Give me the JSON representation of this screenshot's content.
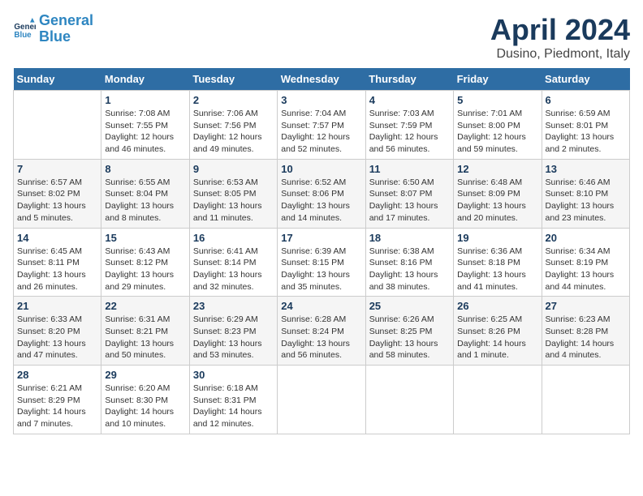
{
  "logo": {
    "line1": "General",
    "line2": "Blue"
  },
  "title": "April 2024",
  "subtitle": "Dusino, Piedmont, Italy",
  "weekdays": [
    "Sunday",
    "Monday",
    "Tuesday",
    "Wednesday",
    "Thursday",
    "Friday",
    "Saturday"
  ],
  "weeks": [
    [
      {
        "day": null
      },
      {
        "day": "1",
        "sunrise": "Sunrise: 7:08 AM",
        "sunset": "Sunset: 7:55 PM",
        "daylight": "Daylight: 12 hours and 46 minutes."
      },
      {
        "day": "2",
        "sunrise": "Sunrise: 7:06 AM",
        "sunset": "Sunset: 7:56 PM",
        "daylight": "Daylight: 12 hours and 49 minutes."
      },
      {
        "day": "3",
        "sunrise": "Sunrise: 7:04 AM",
        "sunset": "Sunset: 7:57 PM",
        "daylight": "Daylight: 12 hours and 52 minutes."
      },
      {
        "day": "4",
        "sunrise": "Sunrise: 7:03 AM",
        "sunset": "Sunset: 7:59 PM",
        "daylight": "Daylight: 12 hours and 56 minutes."
      },
      {
        "day": "5",
        "sunrise": "Sunrise: 7:01 AM",
        "sunset": "Sunset: 8:00 PM",
        "daylight": "Daylight: 12 hours and 59 minutes."
      },
      {
        "day": "6",
        "sunrise": "Sunrise: 6:59 AM",
        "sunset": "Sunset: 8:01 PM",
        "daylight": "Daylight: 13 hours and 2 minutes."
      }
    ],
    [
      {
        "day": "7",
        "sunrise": "Sunrise: 6:57 AM",
        "sunset": "Sunset: 8:02 PM",
        "daylight": "Daylight: 13 hours and 5 minutes."
      },
      {
        "day": "8",
        "sunrise": "Sunrise: 6:55 AM",
        "sunset": "Sunset: 8:04 PM",
        "daylight": "Daylight: 13 hours and 8 minutes."
      },
      {
        "day": "9",
        "sunrise": "Sunrise: 6:53 AM",
        "sunset": "Sunset: 8:05 PM",
        "daylight": "Daylight: 13 hours and 11 minutes."
      },
      {
        "day": "10",
        "sunrise": "Sunrise: 6:52 AM",
        "sunset": "Sunset: 8:06 PM",
        "daylight": "Daylight: 13 hours and 14 minutes."
      },
      {
        "day": "11",
        "sunrise": "Sunrise: 6:50 AM",
        "sunset": "Sunset: 8:07 PM",
        "daylight": "Daylight: 13 hours and 17 minutes."
      },
      {
        "day": "12",
        "sunrise": "Sunrise: 6:48 AM",
        "sunset": "Sunset: 8:09 PM",
        "daylight": "Daylight: 13 hours and 20 minutes."
      },
      {
        "day": "13",
        "sunrise": "Sunrise: 6:46 AM",
        "sunset": "Sunset: 8:10 PM",
        "daylight": "Daylight: 13 hours and 23 minutes."
      }
    ],
    [
      {
        "day": "14",
        "sunrise": "Sunrise: 6:45 AM",
        "sunset": "Sunset: 8:11 PM",
        "daylight": "Daylight: 13 hours and 26 minutes."
      },
      {
        "day": "15",
        "sunrise": "Sunrise: 6:43 AM",
        "sunset": "Sunset: 8:12 PM",
        "daylight": "Daylight: 13 hours and 29 minutes."
      },
      {
        "day": "16",
        "sunrise": "Sunrise: 6:41 AM",
        "sunset": "Sunset: 8:14 PM",
        "daylight": "Daylight: 13 hours and 32 minutes."
      },
      {
        "day": "17",
        "sunrise": "Sunrise: 6:39 AM",
        "sunset": "Sunset: 8:15 PM",
        "daylight": "Daylight: 13 hours and 35 minutes."
      },
      {
        "day": "18",
        "sunrise": "Sunrise: 6:38 AM",
        "sunset": "Sunset: 8:16 PM",
        "daylight": "Daylight: 13 hours and 38 minutes."
      },
      {
        "day": "19",
        "sunrise": "Sunrise: 6:36 AM",
        "sunset": "Sunset: 8:18 PM",
        "daylight": "Daylight: 13 hours and 41 minutes."
      },
      {
        "day": "20",
        "sunrise": "Sunrise: 6:34 AM",
        "sunset": "Sunset: 8:19 PM",
        "daylight": "Daylight: 13 hours and 44 minutes."
      }
    ],
    [
      {
        "day": "21",
        "sunrise": "Sunrise: 6:33 AM",
        "sunset": "Sunset: 8:20 PM",
        "daylight": "Daylight: 13 hours and 47 minutes."
      },
      {
        "day": "22",
        "sunrise": "Sunrise: 6:31 AM",
        "sunset": "Sunset: 8:21 PM",
        "daylight": "Daylight: 13 hours and 50 minutes."
      },
      {
        "day": "23",
        "sunrise": "Sunrise: 6:29 AM",
        "sunset": "Sunset: 8:23 PM",
        "daylight": "Daylight: 13 hours and 53 minutes."
      },
      {
        "day": "24",
        "sunrise": "Sunrise: 6:28 AM",
        "sunset": "Sunset: 8:24 PM",
        "daylight": "Daylight: 13 hours and 56 minutes."
      },
      {
        "day": "25",
        "sunrise": "Sunrise: 6:26 AM",
        "sunset": "Sunset: 8:25 PM",
        "daylight": "Daylight: 13 hours and 58 minutes."
      },
      {
        "day": "26",
        "sunrise": "Sunrise: 6:25 AM",
        "sunset": "Sunset: 8:26 PM",
        "daylight": "Daylight: 14 hours and 1 minute."
      },
      {
        "day": "27",
        "sunrise": "Sunrise: 6:23 AM",
        "sunset": "Sunset: 8:28 PM",
        "daylight": "Daylight: 14 hours and 4 minutes."
      }
    ],
    [
      {
        "day": "28",
        "sunrise": "Sunrise: 6:21 AM",
        "sunset": "Sunset: 8:29 PM",
        "daylight": "Daylight: 14 hours and 7 minutes."
      },
      {
        "day": "29",
        "sunrise": "Sunrise: 6:20 AM",
        "sunset": "Sunset: 8:30 PM",
        "daylight": "Daylight: 14 hours and 10 minutes."
      },
      {
        "day": "30",
        "sunrise": "Sunrise: 6:18 AM",
        "sunset": "Sunset: 8:31 PM",
        "daylight": "Daylight: 14 hours and 12 minutes."
      },
      {
        "day": null
      },
      {
        "day": null
      },
      {
        "day": null
      },
      {
        "day": null
      }
    ]
  ]
}
